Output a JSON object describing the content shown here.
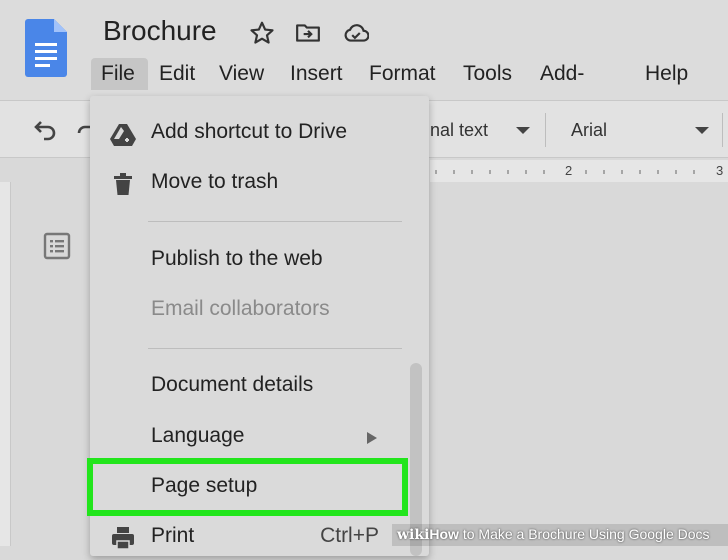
{
  "document": {
    "title": "Brochure"
  },
  "menubar": [
    "File",
    "Edit",
    "View",
    "Insert",
    "Format",
    "Tools",
    "Add-ons",
    "Help"
  ],
  "toolbar": {
    "style": "nal text",
    "font": "Arial"
  },
  "ruler": {
    "marks": [
      "2",
      "3"
    ]
  },
  "file_menu": {
    "add_shortcut": "Add shortcut to Drive",
    "move_to_trash": "Move to trash",
    "publish": "Publish to the web",
    "email_collaborators": "Email collaborators",
    "document_details": "Document details",
    "language": "Language",
    "page_setup": "Page setup",
    "print": "Print",
    "print_shortcut": "Ctrl+P"
  },
  "watermark": {
    "brand": "wiki",
    "how": "How",
    "text": " to Make a Brochure Using Google Docs"
  },
  "colors": {
    "highlight": "#22e51c",
    "docs_blue": "#4a86e8"
  }
}
